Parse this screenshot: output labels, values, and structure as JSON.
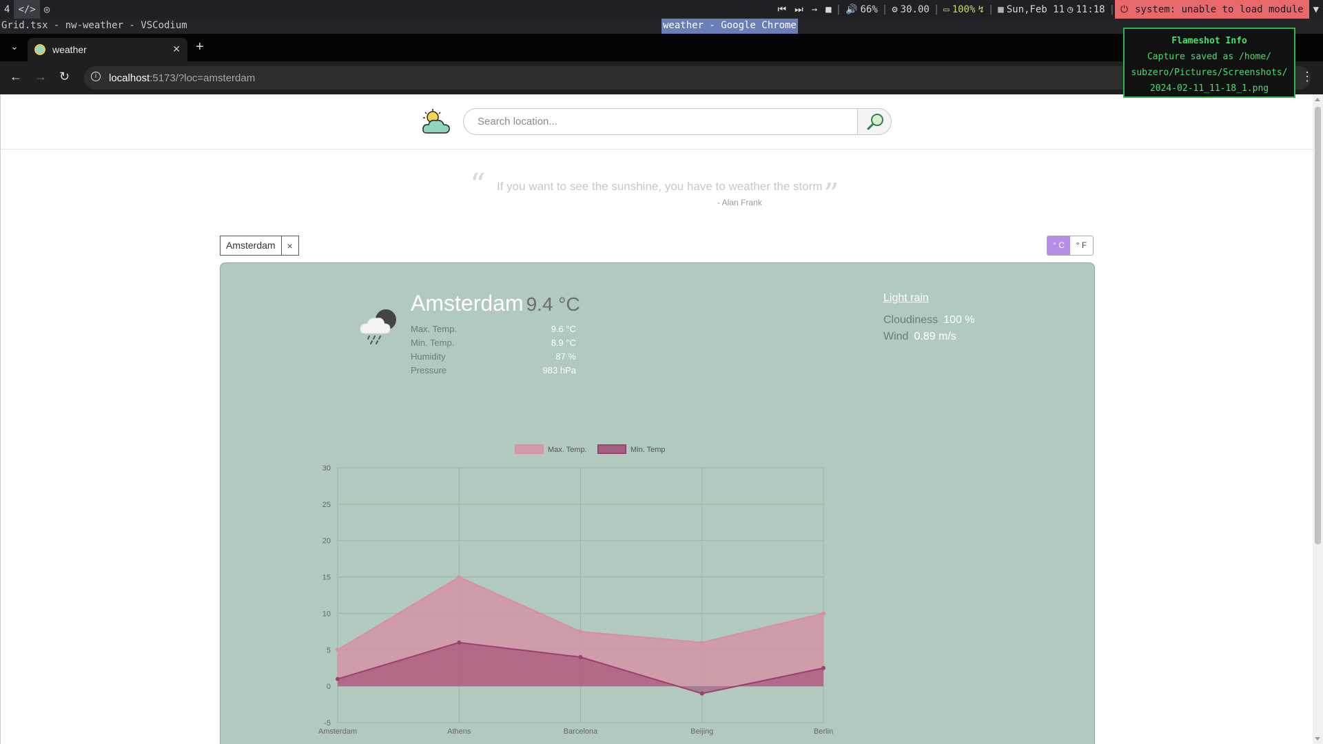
{
  "system_bar": {
    "workspace": "4",
    "volume": "66%",
    "cpu": "30.00",
    "battery": "100%",
    "date": "Sun,Feb 11",
    "time": "11:18",
    "error": "system: unable to load module"
  },
  "title_bar": {
    "left": "Grid.tsx - nw-weather - VSCodium",
    "center": "weather - Google Chrome"
  },
  "browser": {
    "tab_title": "weather",
    "url_host": "localhost",
    "url_path": ":5173/?loc=amsterdam"
  },
  "flameshot": {
    "title": "Flameshot Info",
    "line1": "Capture saved as /home/",
    "line2": "subzero/Pictures/Screenshots/",
    "line3": "2024-02-11_11-18_1.png"
  },
  "search": {
    "placeholder": "Search location..."
  },
  "quote": {
    "text": "If you want to see the sunshine, you have to weather the storm",
    "author": "- Alan Frank"
  },
  "chip": {
    "label": "Amsterdam",
    "close": "×"
  },
  "units": {
    "celsius": "° C",
    "fahrenheit": "° F"
  },
  "weather": {
    "city": "Amsterdam",
    "temp": "9.4 °C",
    "description": "Light rain",
    "stats": [
      {
        "label": "Max. Temp.",
        "value": "9.6 °C"
      },
      {
        "label": "Min. Temp.",
        "value": "8.9 °C"
      },
      {
        "label": "Humidity",
        "value": "87 %"
      },
      {
        "label": "Pressure",
        "value": "983 hPa"
      }
    ],
    "cloudiness_label": "Cloudiness",
    "cloudiness_value": "100 %",
    "wind_label": "Wind",
    "wind_value": "0.89 m/s"
  },
  "chart_data": {
    "type": "area",
    "categories": [
      "Amsterdam",
      "Athens",
      "Barcelona",
      "Beijing",
      "Berlin"
    ],
    "series": [
      {
        "name": "Max. Temp.",
        "values": [
          5,
          15,
          7.5,
          6,
          10
        ],
        "color": "#d98ea3"
      },
      {
        "name": "Min. Temp",
        "values": [
          1,
          6,
          4,
          -1,
          2.5
        ],
        "color": "#9c3f6d"
      }
    ],
    "yticks": [
      30,
      25,
      20,
      15,
      10,
      5,
      0,
      -5
    ],
    "ylim": [
      -5,
      30
    ],
    "grid": true,
    "legend": "top"
  }
}
